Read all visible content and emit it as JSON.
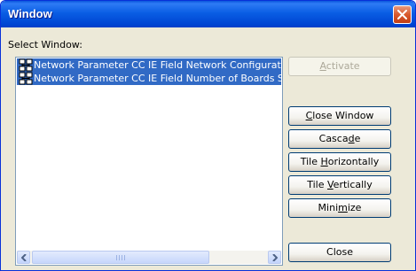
{
  "window": {
    "title": "Window"
  },
  "select_label": "Select Window:",
  "list": {
    "items": [
      {
        "label": "Network Parameter CC IE Field Network Configuration S",
        "icon": "network-parameter-icon"
      },
      {
        "label": "Network Parameter CC IE Field Number of Boards Settin",
        "icon": "network-parameter-icon"
      }
    ],
    "selected_count": 2
  },
  "buttons": {
    "activate": {
      "pre": "",
      "key": "A",
      "post": "ctivate",
      "enabled": false
    },
    "close_window": {
      "pre": "",
      "key": "C",
      "post": "lose Window",
      "enabled": true
    },
    "cascade": {
      "pre": "Casca",
      "key": "d",
      "post": "e",
      "enabled": true
    },
    "tile_h": {
      "pre": "Tile ",
      "key": "H",
      "post": "orizontally",
      "enabled": true
    },
    "tile_v": {
      "pre": "Tile ",
      "key": "V",
      "post": "ertically",
      "enabled": true
    },
    "minimize": {
      "pre": "Mini",
      "key": "m",
      "post": "ize",
      "enabled": true
    },
    "close": {
      "pre": "Close",
      "key": "",
      "post": "",
      "enabled": true
    }
  },
  "colors": {
    "titlebar": "#0054e3",
    "selection": "#316ac5",
    "face": "#ece9d8"
  }
}
